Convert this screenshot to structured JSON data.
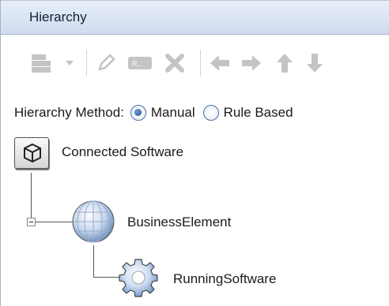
{
  "panel": {
    "title": "Hierarchy"
  },
  "toolbar": {
    "buttons": [
      {
        "icon": "new-menu-icon",
        "enabled": false
      },
      {
        "icon": "dropdown-arrow-icon",
        "enabled": false
      },
      {
        "icon": "edit-pencil-icon",
        "enabled": false
      },
      {
        "icon": "rename-icon",
        "enabled": false
      },
      {
        "icon": "delete-x-icon",
        "enabled": false
      },
      {
        "icon": "arrow-left-icon",
        "enabled": false
      },
      {
        "icon": "arrow-right-icon",
        "enabled": false
      },
      {
        "icon": "arrow-up-icon",
        "enabled": false
      },
      {
        "icon": "arrow-down-icon",
        "enabled": false
      }
    ],
    "disabled_color": "#c4c4c4"
  },
  "hierarchy_method": {
    "label": "Hierarchy Method:",
    "options": [
      {
        "label": "Manual",
        "selected": true
      },
      {
        "label": "Rule Based",
        "selected": false
      }
    ]
  },
  "tree": {
    "root": {
      "label": "Connected Software",
      "icon": "cube-icon"
    },
    "child": {
      "label": "BusinessElement",
      "icon": "globe-icon",
      "expanded": true
    },
    "grandchild": {
      "label": "RunningSoftware",
      "icon": "gear-icon"
    }
  }
}
